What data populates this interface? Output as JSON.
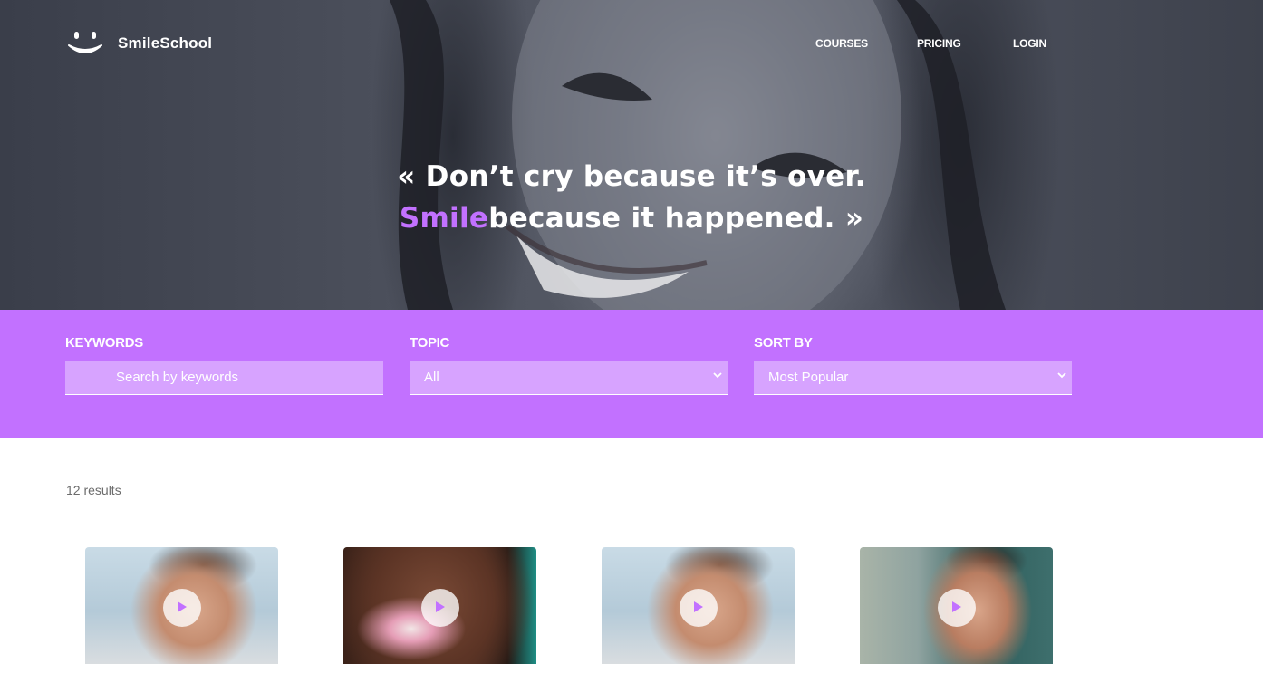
{
  "brand": {
    "name": "SmileSchool"
  },
  "nav": {
    "courses": "COURSES",
    "pricing": "PRICING",
    "login": "LOGIN"
  },
  "hero": {
    "quote_line1": "« Don’t cry because it’s over.",
    "quote_accent": "Smile",
    "quote_line2_rest": "because it happened. »"
  },
  "filters": {
    "keywords": {
      "label": "KEYWORDS",
      "placeholder": "Search by keywords"
    },
    "topic": {
      "label": "TOPIC",
      "value": "All"
    },
    "sort": {
      "label": "SORT BY",
      "value": "Most Popular"
    }
  },
  "results": {
    "count_text": "12 results"
  },
  "cards": [
    {
      "thumb": "man-glasses-smiling",
      "icon": "play-icon"
    },
    {
      "thumb": "woman-braids-smiling",
      "icon": "play-icon"
    },
    {
      "thumb": "man-glasses-smiling",
      "icon": "play-icon"
    },
    {
      "thumb": "man-smiling",
      "icon": "play-icon"
    }
  ],
  "colors": {
    "accent": "#c271ff",
    "input_bg": "#d7a3ff",
    "white": "#ffffff"
  }
}
